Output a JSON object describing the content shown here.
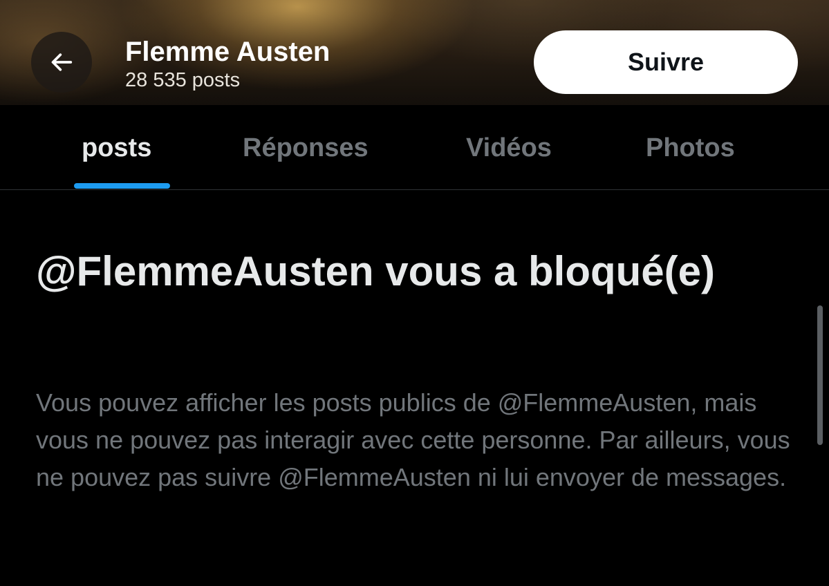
{
  "header": {
    "back_icon": "arrow-left-icon",
    "profile_name": "Flemme Austen",
    "post_count": "28 535 posts",
    "follow_label": "Suivre"
  },
  "tabs": [
    {
      "label": "posts",
      "active": true
    },
    {
      "label": "Réponses",
      "active": false
    },
    {
      "label": "Vidéos",
      "active": false
    },
    {
      "label": "Photos",
      "active": false
    }
  ],
  "blocked": {
    "title": "@FlemmeAusten vous a bloqué(e)",
    "description": "Vous pouvez afficher les posts publics de @FlemmeAusten, mais vous ne pouvez pas interagir avec cette personne. Par ailleurs, vous ne pouvez pas suivre @FlemmeAusten ni lui envoyer de messages."
  },
  "colors": {
    "background": "#000000",
    "accent": "#1d9bf0",
    "primary_text": "#e7e9ea",
    "secondary_text": "#71767b",
    "follow_button_bg": "#ffffff"
  }
}
